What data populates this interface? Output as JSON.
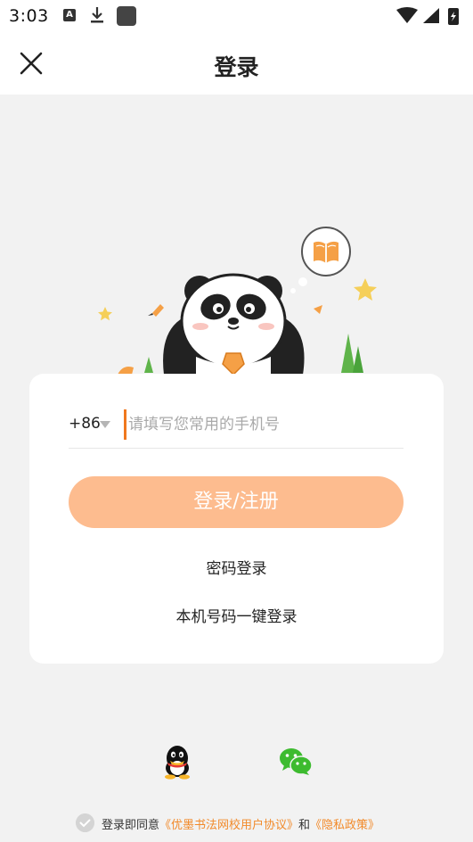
{
  "status": {
    "time": "3:03",
    "icon_a": "A"
  },
  "nav": {
    "title": "登录",
    "close_icon": "close-icon"
  },
  "login": {
    "country_code": "+86",
    "phone_placeholder": "请填写您常用的手机号",
    "phone_value": "",
    "submit_label": "登录/注册",
    "password_login_label": "密码登录",
    "one_key_login_label": "本机号码一键登录"
  },
  "social": {
    "qq_icon": "qq-icon",
    "wechat_icon": "wechat-icon"
  },
  "agreement": {
    "prefix": "登录即同意",
    "user_agreement": "《优墨书法网校用户协议》",
    "and": "和",
    "privacy_policy": "《隐私政策》"
  },
  "colors": {
    "accent": "#f28a2a",
    "button": "#fdbc8f",
    "background": "#f2f2f2",
    "wechat": "#3dbb2f"
  }
}
